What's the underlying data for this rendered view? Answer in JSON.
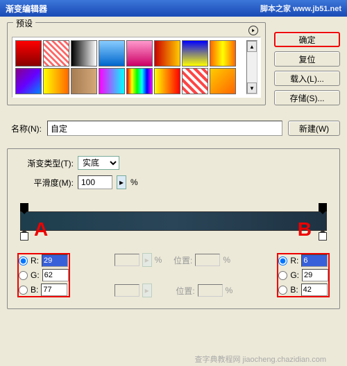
{
  "window": {
    "title": "渐变编辑器",
    "watermark": "脚本之家  www.jb51.net"
  },
  "presets": {
    "label": "预设"
  },
  "buttons": {
    "ok": "确定",
    "reset": "复位",
    "load": "载入(L)...",
    "save": "存储(S)..."
  },
  "name": {
    "label": "名称(N):",
    "value": "自定",
    "new": "新建(W)"
  },
  "gradient": {
    "type_label": "渐变类型(T):",
    "type_value": "实底",
    "smooth_label": "平滑度(M):",
    "smooth_value": "100",
    "pct": "%"
  },
  "markers": {
    "a": "A",
    "b": "B"
  },
  "rgb_left": {
    "r": "29",
    "g": "62",
    "b": "77"
  },
  "rgb_right": {
    "r": "6",
    "g": "29",
    "b": "42"
  },
  "mid": {
    "pct": "%",
    "loc": "位置:"
  },
  "footer_watermark": "查字典教程网 jiaocheng.chazidian.com",
  "swatches": [
    "linear-gradient(to bottom,#f00,#800)",
    "repeating-linear-gradient(45deg,#fff,#fff 3px,#f66 3px,#f66 6px)",
    "linear-gradient(to right,#000,#fff)",
    "linear-gradient(to bottom,#8cf,#06c)",
    "linear-gradient(to bottom,#f9c,#c06)",
    "linear-gradient(to right,#c00,#fc0)",
    "linear-gradient(to bottom,#00f,#ff0)",
    "linear-gradient(to right,#f60,#ff0,#f60)",
    "linear-gradient(135deg,#808,#60f,#08f)",
    "linear-gradient(to right,#ff0,#f60)",
    "linear-gradient(to right,#a67c52,#d4a878)",
    "linear-gradient(to right,#f0f,#0ff)",
    "linear-gradient(to right,#f00,#ff0,#0f0,#0ff,#00f,#f0f)",
    "linear-gradient(to right,#ff0,#f00)",
    "repeating-linear-gradient(45deg,#fff,#fff 4px,#f44 4px,#f44 8px)",
    "linear-gradient(135deg,#fc0,#f60)"
  ]
}
